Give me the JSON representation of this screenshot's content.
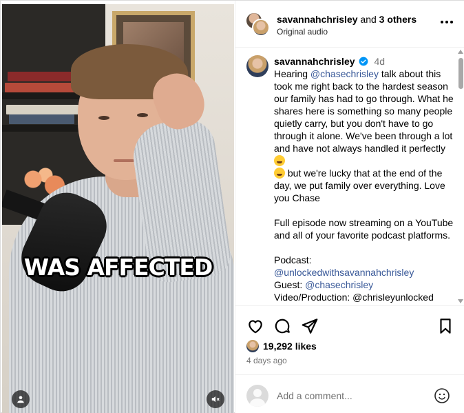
{
  "media": {
    "overlay_caption": "WAS AFFECTED",
    "tag_people_icon": "person-tag-icon",
    "mute_icon": "speaker-muted-icon"
  },
  "header": {
    "username": "savannahchrisley",
    "and_text": " and ",
    "others_text": "3 others",
    "audio": "Original audio",
    "more_icon": "more-horizontal-icon"
  },
  "caption": {
    "username": "savannahchrisley",
    "time": "4d",
    "line1_pre": "Hearing ",
    "mention1": "@chasechrisley",
    "line1_post": " talk about this took me right back to the hardest season our family has had to go through. What he shares here is something so many people quietly carry, but you don't have to go through it alone. We've been through a lot and have not always handled it perfectly ",
    "mid": " but we're lucky that at the end of the day, we put family over everything. Love you Chase",
    "para2": "Full episode now streaming on a YouTube and all of your favorite podcast platforms.",
    "podcast_label": "Podcast:",
    "podcast_handle": "@unlockedwithsavannahchrisley",
    "guest_label": "Guest: ",
    "guest_handle": "@chasechrisley",
    "cutoff_line": "Video/Production: @chrisleyunlocked"
  },
  "actions": {
    "likes": "19,292 likes",
    "time_ago": "4 days ago"
  },
  "comment": {
    "placeholder": "Add a comment..."
  },
  "colors": {
    "mention": "#385898",
    "verified": "#0095f6",
    "secondary_text": "#737373"
  }
}
